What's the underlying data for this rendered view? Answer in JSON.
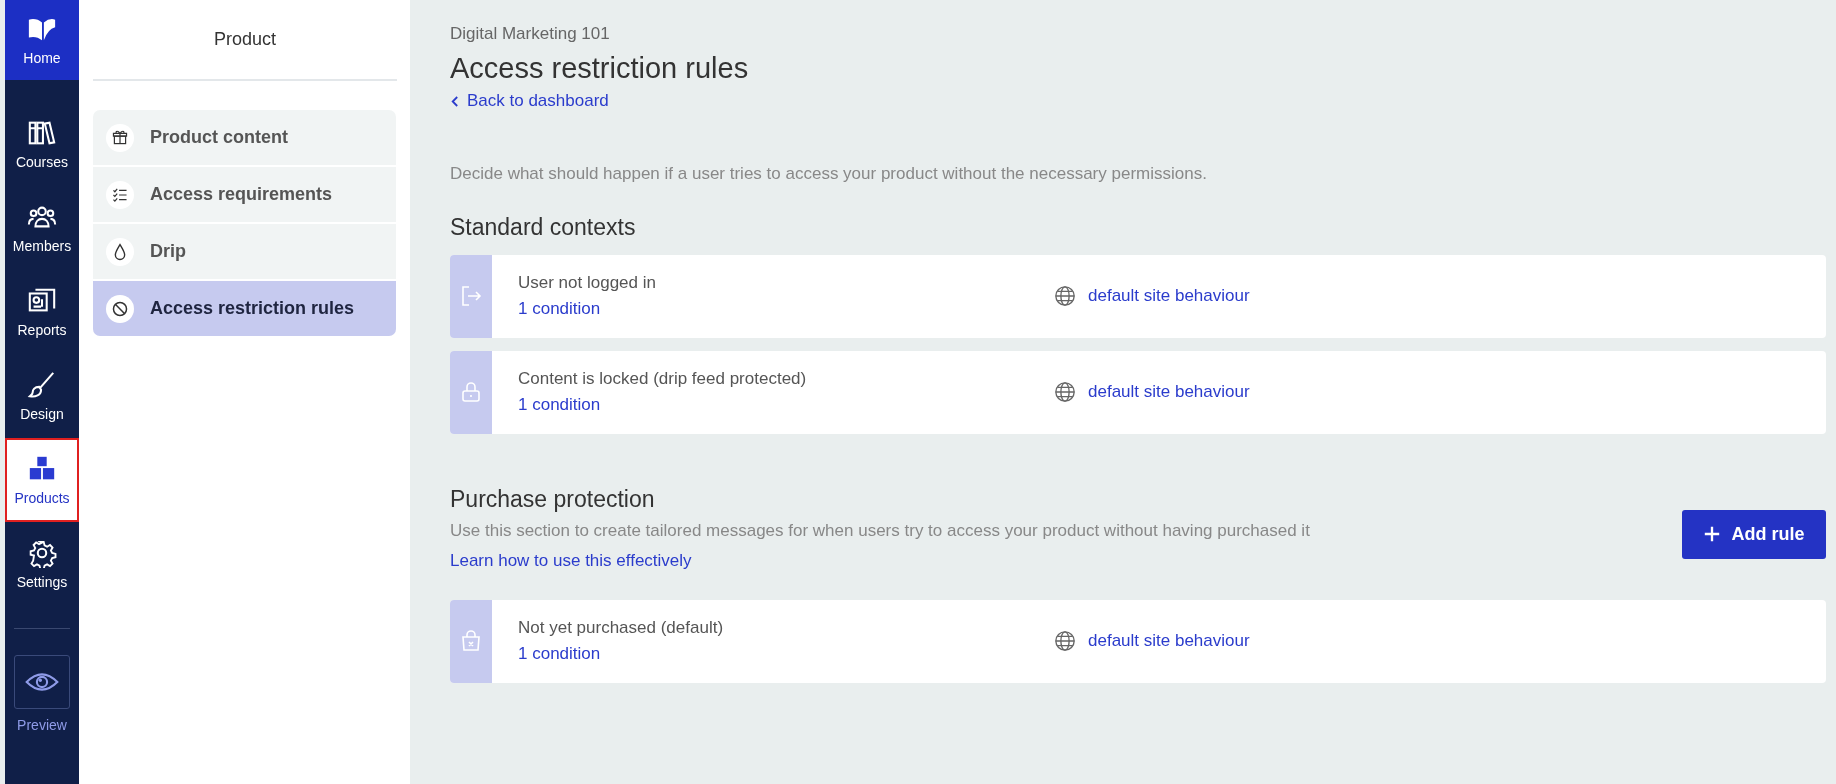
{
  "nav": {
    "items": [
      {
        "kind": "home",
        "label": "Home",
        "selected": false
      },
      {
        "kind": "courses",
        "label": "Courses",
        "selected": false
      },
      {
        "kind": "members",
        "label": "Members",
        "selected": false
      },
      {
        "kind": "reports",
        "label": "Reports",
        "selected": false
      },
      {
        "kind": "design",
        "label": "Design",
        "selected": false
      },
      {
        "kind": "products",
        "label": "Products",
        "selected": true
      },
      {
        "kind": "settings",
        "label": "Settings",
        "selected": false
      }
    ],
    "preview": {
      "label": "Preview"
    }
  },
  "sidebar": {
    "title": "Product",
    "items": [
      {
        "kind": "box",
        "label": "Product content",
        "selected": false
      },
      {
        "kind": "checklist",
        "label": "Access requirements",
        "selected": false
      },
      {
        "kind": "drop",
        "label": "Drip",
        "selected": false
      },
      {
        "kind": "blocked",
        "label": "Access restriction rules",
        "selected": true
      }
    ]
  },
  "header": {
    "breadcrumb": "Digital Marketing 101",
    "title": "Access restriction rules",
    "back_link": "Back to dashboard"
  },
  "description": "Decide what should happen if a user tries to access your product without the necessary permissions.",
  "standard_contexts": {
    "heading": "Standard contexts",
    "rules": [
      {
        "kind": "logout",
        "name": "User not logged in",
        "conditions": "1 condition",
        "behaviour": "default site behaviour"
      },
      {
        "kind": "lock",
        "name": "Content is locked (drip feed protected)",
        "conditions": "1 condition",
        "behaviour": "default site behaviour"
      }
    ]
  },
  "purchase_protection": {
    "heading": "Purchase protection",
    "description": "Use this section to create tailored messages for when users try to access your product without having purchased it",
    "learn_link": "Learn how to use this effectively",
    "add_button": "Add rule",
    "rules": [
      {
        "kind": "bag",
        "name": "Not yet purchased (default)",
        "conditions": "1 condition",
        "behaviour": "default site behaviour"
      }
    ]
  }
}
